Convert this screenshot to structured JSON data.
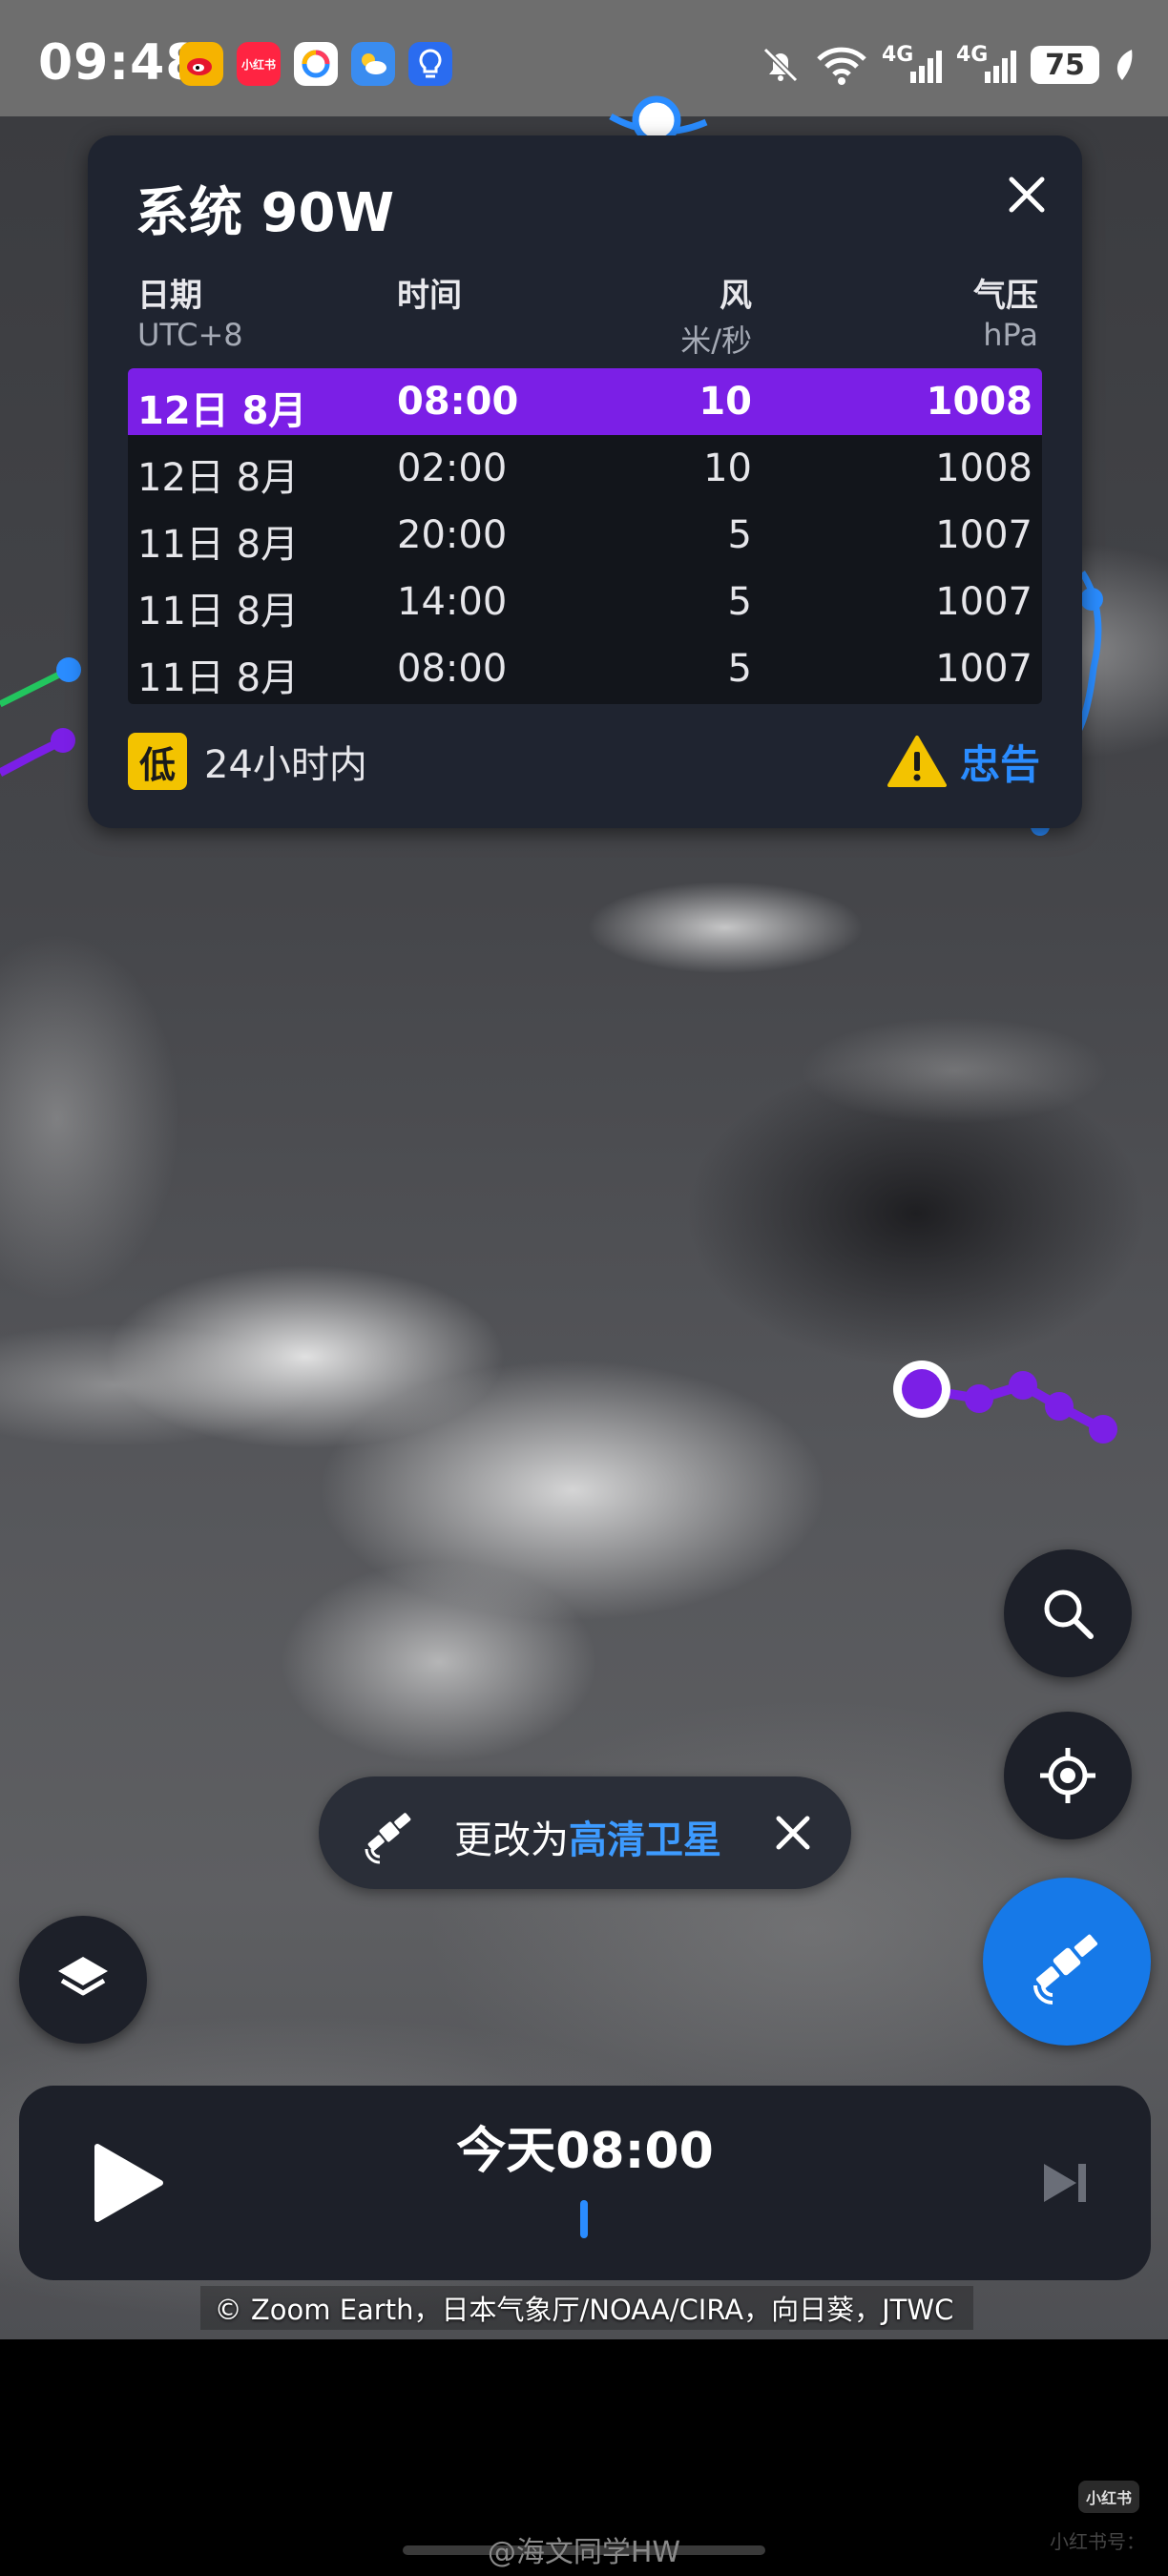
{
  "status_bar": {
    "time": "09:48",
    "app_icons": [
      {
        "name": "weibo-icon",
        "label": "",
        "color": "#f6b300"
      },
      {
        "name": "xiaohongshu-icon",
        "label": "小红书",
        "color": "#ff2442"
      },
      {
        "name": "app-icon-ring",
        "label": "",
        "color": "#ffffff"
      },
      {
        "name": "weather-icon",
        "label": "",
        "color": "#3a8cf0"
      },
      {
        "name": "bulb-icon",
        "label": "",
        "color": "#2a6cf0"
      }
    ],
    "network_1": "4G",
    "network_2": "4G",
    "battery": "75"
  },
  "storm_panel": {
    "title": "系统 90W",
    "columns": {
      "date": "日期",
      "date_unit": "UTC+8",
      "time": "时间",
      "wind": "风",
      "wind_unit": "米/秒",
      "pressure": "气压",
      "pressure_unit": "hPa"
    },
    "rows": [
      {
        "date": "12日 8月",
        "time": "08:00",
        "wind": "10",
        "pressure": "1008",
        "selected": true
      },
      {
        "date": "12日 8月",
        "time": "02:00",
        "wind": "10",
        "pressure": "1008",
        "selected": false
      },
      {
        "date": "11日 8月",
        "time": "20:00",
        "wind": "5",
        "pressure": "1007",
        "selected": false
      },
      {
        "date": "11日 8月",
        "time": "14:00",
        "wind": "5",
        "pressure": "1007",
        "selected": false
      },
      {
        "date": "11日 8月",
        "time": "08:00",
        "wind": "5",
        "pressure": "1007",
        "selected": false
      }
    ],
    "intensity_badge": "低",
    "intensity_text": "24小时内",
    "advisory_label": "忠告",
    "highlight_color": "#7b1fe6"
  },
  "toast": {
    "prefix": "更改为",
    "link": "高清卫星"
  },
  "timeline": {
    "label": "今天08:00"
  },
  "attribution": "© Zoom Earth，日本气象厅/NOAA/CIRA，向日葵，JTWC",
  "watermark": "@海文同学HW",
  "xhs_logo": "小红书",
  "xhs_id": "小红书号：",
  "colors": {
    "accent_blue": "#1679e8",
    "storm_purple": "#7b1fe6",
    "track_green": "#22c55e",
    "warning_yellow": "#f3c300"
  }
}
